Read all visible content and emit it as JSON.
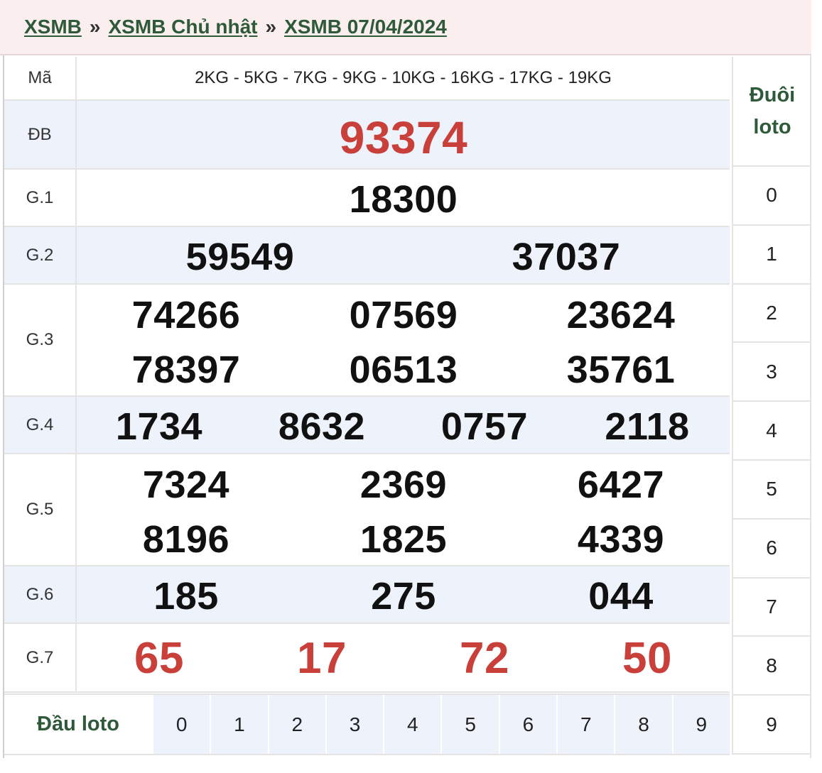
{
  "breadcrumb": {
    "home": "XSMB",
    "sep1": "»",
    "day": "XSMB Chủ nhật",
    "sep2": "»",
    "date": "XSMB 07/04/2024"
  },
  "codes": {
    "label": "Mã",
    "value": "2KG - 5KG - 7KG - 9KG - 10KG - 16KG - 17KG - 19KG"
  },
  "prizes": {
    "db": {
      "label": "ĐB",
      "numbers": [
        "93374"
      ]
    },
    "g1": {
      "label": "G.1",
      "numbers": [
        "18300"
      ]
    },
    "g2": {
      "label": "G.2",
      "numbers": [
        "59549",
        "37037"
      ]
    },
    "g3": {
      "label": "G.3",
      "numbers": [
        "74266",
        "07569",
        "23624",
        "78397",
        "06513",
        "35761"
      ]
    },
    "g4": {
      "label": "G.4",
      "numbers": [
        "1734",
        "8632",
        "0757",
        "2118"
      ]
    },
    "g5": {
      "label": "G.5",
      "numbers": [
        "7324",
        "2369",
        "6427",
        "8196",
        "1825",
        "4339"
      ]
    },
    "g6": {
      "label": "G.6",
      "numbers": [
        "185",
        "275",
        "044"
      ]
    },
    "g7": {
      "label": "G.7",
      "numbers": [
        "65",
        "17",
        "72",
        "50"
      ]
    }
  },
  "duoi_loto": {
    "title": "Đuôi loto",
    "digits": [
      "0",
      "1",
      "2",
      "3",
      "4",
      "5",
      "6",
      "7",
      "8",
      "9"
    ]
  },
  "dau_loto": {
    "title": "Đầu loto",
    "digits": [
      "0",
      "1",
      "2",
      "3",
      "4",
      "5",
      "6",
      "7",
      "8",
      "9"
    ]
  },
  "colors": {
    "link_green": "#2e5a3a",
    "highlight_red": "#c9403a",
    "alt_row_bg": "#eef2fb",
    "header_bg": "#fbeeee"
  }
}
